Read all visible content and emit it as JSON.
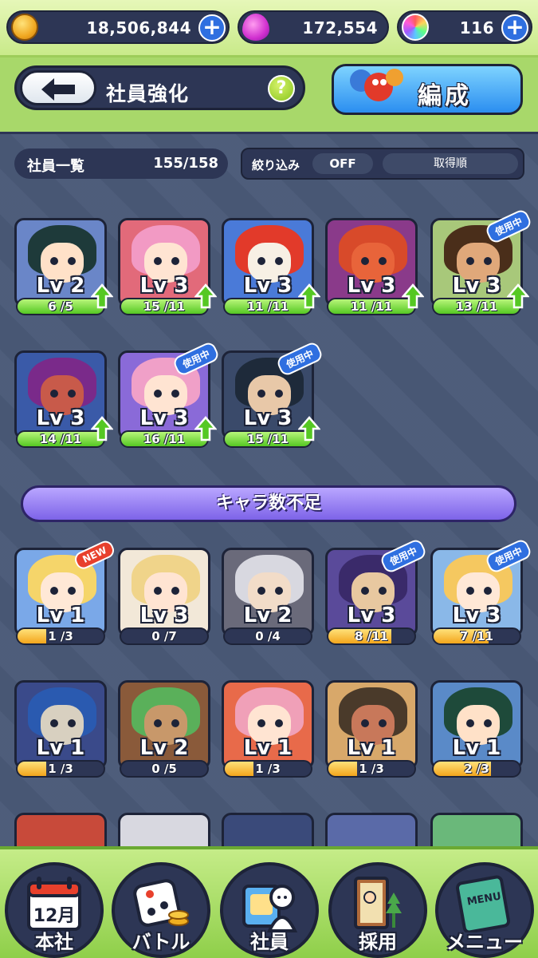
{
  "currency": {
    "coins": "18,506,844",
    "drops": "172,554",
    "orbs": "116"
  },
  "header": {
    "title": "社員強化",
    "help": "?",
    "formation_label": "編成"
  },
  "list": {
    "title": "社員一覧",
    "count": "155/158",
    "filter_label": "絞り込み",
    "filter_state": "OFF",
    "sort_label": "取得順"
  },
  "in_use_tag": "使用中",
  "new_tag": "NEW",
  "shortage_label": "キャラ数不足",
  "cards_upgradable": [
    {
      "level": "Lv 2",
      "count": "6",
      "need": "/5",
      "hair": "#1e3a3a",
      "skin": "#ffe1c8",
      "bg": "#6a86c8",
      "in_use": false
    },
    {
      "level": "Lv 3",
      "count": "15",
      "need": "/11",
      "hair": "#f29ac4",
      "skin": "#ffe4d2",
      "bg": "#e26a7a",
      "in_use": false
    },
    {
      "level": "Lv 3",
      "count": "11",
      "need": "/11",
      "hair": "#e23a2a",
      "skin": "#f7f0e4",
      "bg": "#4a7ad8",
      "in_use": false
    },
    {
      "level": "Lv 3",
      "count": "11",
      "need": "/11",
      "hair": "#d84a2a",
      "skin": "#e8643a",
      "bg": "#8a3a8a",
      "in_use": false
    },
    {
      "level": "Lv 3",
      "count": "13",
      "need": "/11",
      "hair": "#4a2e1a",
      "skin": "#e0a87a",
      "bg": "#a8c87a",
      "in_use": true
    },
    {
      "level": "Lv 3",
      "count": "14",
      "need": "/11",
      "hair": "#7a2a8a",
      "skin": "#c85a4a",
      "bg": "#3a5aa8",
      "in_use": false
    },
    {
      "level": "Lv 3",
      "count": "16",
      "need": "/11",
      "hair": "#f0a0c8",
      "skin": "#ffe4d2",
      "bg": "#8a6ad8",
      "in_use": true
    },
    {
      "level": "Lv 3",
      "count": "15",
      "need": "/11",
      "hair": "#1e2a3a",
      "skin": "#e8c8a8",
      "bg": "#3a4a6a",
      "in_use": true
    }
  ],
  "cards_other": [
    {
      "level": "Lv 1",
      "count": "1",
      "need": "/3",
      "hair": "#f5d56a",
      "skin": "#ffe8d6",
      "bg": "#7aa8e8",
      "tag": "new"
    },
    {
      "level": "Lv 3",
      "count": "0",
      "need": "/7",
      "hair": "#f0d48a",
      "skin": "#ffe4d2",
      "bg": "#f2e8d8",
      "tag": ""
    },
    {
      "level": "Lv 2",
      "count": "0",
      "need": "/4",
      "hair": "#d8d8e0",
      "skin": "#f2dcc8",
      "bg": "#6a6a7a",
      "tag": ""
    },
    {
      "level": "Lv 3",
      "count": "8",
      "need": "/11",
      "hair": "#3a2a6a",
      "skin": "#e8c8a0",
      "bg": "#5a4a9a",
      "tag": "use"
    },
    {
      "level": "Lv 3",
      "count": "7",
      "need": "/11",
      "hair": "#f5c860",
      "skin": "#ffe8d6",
      "bg": "#8ab8e8",
      "tag": "use"
    },
    {
      "level": "Lv 1",
      "count": "1",
      "need": "/3",
      "hair": "#2a5ab0",
      "skin": "#d8d0c0",
      "bg": "#3a4a8a",
      "tag": ""
    },
    {
      "level": "Lv 2",
      "count": "0",
      "need": "/5",
      "hair": "#5ab05a",
      "skin": "#c8986a",
      "bg": "#8a5a3a",
      "tag": ""
    },
    {
      "level": "Lv 1",
      "count": "1",
      "need": "/3",
      "hair": "#f0a0b8",
      "skin": "#ffe4d2",
      "bg": "#e86a4a",
      "tag": ""
    },
    {
      "level": "Lv 1",
      "count": "1",
      "need": "/3",
      "hair": "#4a3a2a",
      "skin": "#c8785a",
      "bg": "#d8a86a",
      "tag": ""
    },
    {
      "level": "Lv 1",
      "count": "2",
      "need": "/3",
      "hair": "#1e4a3a",
      "skin": "#ffe1c8",
      "bg": "#5a8ac8",
      "tag": ""
    }
  ],
  "nav": [
    {
      "label": "本社",
      "icon": "calendar-icon",
      "calendar_text": "12月"
    },
    {
      "label": "バトル",
      "icon": "dice-icon"
    },
    {
      "label": "社員",
      "icon": "employee-card-icon"
    },
    {
      "label": "採用",
      "icon": "door-icon"
    },
    {
      "label": "メニュー",
      "icon": "menu-book-icon",
      "book_text": "MENU"
    }
  ]
}
